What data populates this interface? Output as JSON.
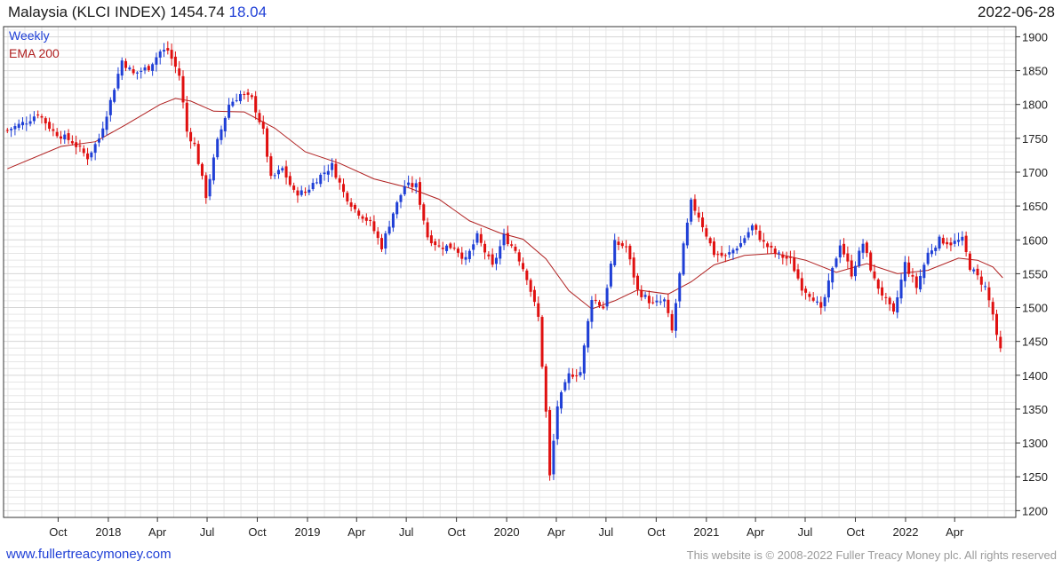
{
  "header": {
    "title": "Malaysia (KLCI INDEX) 1454.74",
    "change": "18.04",
    "date": "2022-06-28"
  },
  "footer": {
    "url": "www.fullertreacymoney.com",
    "copyright": "This website is © 2008-2022 Fuller Treacy Money plc. All rights reserved"
  },
  "colors": {
    "up": "#1f3fd6",
    "down": "#e01010",
    "ema": "#b02020",
    "grid": "#e6e6e6",
    "frame": "#333333"
  },
  "chart_data": {
    "type": "line",
    "subtype": "weekly candlestick with moving average",
    "title": "",
    "xlabel": "",
    "ylabel": "",
    "x_start": "2017-06-23",
    "x_end": "2022-07-22",
    "x_ticks": [
      {
        "label": "Oct",
        "date": "2017-10-01"
      },
      {
        "label": "2018",
        "date": "2018-01-01"
      },
      {
        "label": "Apr",
        "date": "2018-04-01"
      },
      {
        "label": "Jul",
        "date": "2018-07-01"
      },
      {
        "label": "Oct",
        "date": "2018-10-01"
      },
      {
        "label": "2019",
        "date": "2019-01-01"
      },
      {
        "label": "Apr",
        "date": "2019-04-01"
      },
      {
        "label": "Jul",
        "date": "2019-07-01"
      },
      {
        "label": "Oct",
        "date": "2019-10-01"
      },
      {
        "label": "2020",
        "date": "2020-01-01"
      },
      {
        "label": "Apr",
        "date": "2020-04-01"
      },
      {
        "label": "Jul",
        "date": "2020-07-01"
      },
      {
        "label": "Oct",
        "date": "2020-10-01"
      },
      {
        "label": "2021",
        "date": "2021-01-01"
      },
      {
        "label": "Apr",
        "date": "2021-04-01"
      },
      {
        "label": "Jul",
        "date": "2021-07-01"
      },
      {
        "label": "Oct",
        "date": "2021-10-01"
      },
      {
        "label": "2022",
        "date": "2022-01-01"
      },
      {
        "label": "Apr",
        "date": "2022-04-01"
      }
    ],
    "ylim": [
      1190,
      1915
    ],
    "y_ticks": [
      1200,
      1250,
      1300,
      1350,
      1400,
      1450,
      1500,
      1550,
      1600,
      1650,
      1700,
      1750,
      1800,
      1850,
      1900
    ],
    "grid": true,
    "legend_position": "top-left",
    "series": [
      {
        "name": "Weekly",
        "kind": "candlestick",
        "start_date": "2017-06-30",
        "interval_days": 7,
        "anchors": [
          {
            "date": "2017-06-30",
            "close": 1762
          },
          {
            "date": "2017-08-04",
            "close": 1775
          },
          {
            "date": "2017-08-25",
            "close": 1787
          },
          {
            "date": "2017-09-22",
            "close": 1760
          },
          {
            "date": "2017-10-27",
            "close": 1745
          },
          {
            "date": "2017-11-24",
            "close": 1722
          },
          {
            "date": "2017-12-15",
            "close": 1750
          },
          {
            "date": "2018-01-05",
            "close": 1805
          },
          {
            "date": "2018-01-26",
            "close": 1865
          },
          {
            "date": "2018-02-16",
            "close": 1845
          },
          {
            "date": "2018-03-16",
            "close": 1855
          },
          {
            "date": "2018-04-06",
            "close": 1878
          },
          {
            "date": "2018-04-20",
            "close": 1880
          },
          {
            "date": "2018-05-11",
            "close": 1843
          },
          {
            "date": "2018-05-25",
            "close": 1760
          },
          {
            "date": "2018-06-08",
            "close": 1740
          },
          {
            "date": "2018-06-29",
            "close": 1665
          },
          {
            "date": "2018-07-20",
            "close": 1745
          },
          {
            "date": "2018-08-10",
            "close": 1800
          },
          {
            "date": "2018-08-31",
            "close": 1815
          },
          {
            "date": "2018-09-21",
            "close": 1808
          },
          {
            "date": "2018-10-12",
            "close": 1760
          },
          {
            "date": "2018-10-26",
            "close": 1690
          },
          {
            "date": "2018-11-16",
            "close": 1705
          },
          {
            "date": "2018-12-07",
            "close": 1670
          },
          {
            "date": "2018-12-28",
            "close": 1670
          },
          {
            "date": "2019-01-18",
            "close": 1690
          },
          {
            "date": "2019-02-15",
            "close": 1710
          },
          {
            "date": "2019-03-08",
            "close": 1670
          },
          {
            "date": "2019-03-29",
            "close": 1645
          },
          {
            "date": "2019-04-26",
            "close": 1625
          },
          {
            "date": "2019-05-17",
            "close": 1590
          },
          {
            "date": "2019-06-07",
            "close": 1640
          },
          {
            "date": "2019-06-28",
            "close": 1680
          },
          {
            "date": "2019-07-19",
            "close": 1680
          },
          {
            "date": "2019-08-09",
            "close": 1605
          },
          {
            "date": "2019-08-30",
            "close": 1590
          },
          {
            "date": "2019-09-27",
            "close": 1590
          },
          {
            "date": "2019-10-18",
            "close": 1570
          },
          {
            "date": "2019-11-08",
            "close": 1605
          },
          {
            "date": "2019-12-06",
            "close": 1560
          },
          {
            "date": "2019-12-27",
            "close": 1605
          },
          {
            "date": "2020-01-17",
            "close": 1585
          },
          {
            "date": "2020-02-07",
            "close": 1545
          },
          {
            "date": "2020-02-28",
            "close": 1485
          },
          {
            "date": "2020-03-13",
            "close": 1345
          },
          {
            "date": "2020-03-20",
            "close": 1250
          },
          {
            "date": "2020-04-03",
            "close": 1355
          },
          {
            "date": "2020-04-24",
            "close": 1400
          },
          {
            "date": "2020-05-15",
            "close": 1405
          },
          {
            "date": "2020-06-05",
            "close": 1515
          },
          {
            "date": "2020-06-26",
            "close": 1500
          },
          {
            "date": "2020-07-17",
            "close": 1595
          },
          {
            "date": "2020-08-07",
            "close": 1590
          },
          {
            "date": "2020-08-28",
            "close": 1525
          },
          {
            "date": "2020-09-25",
            "close": 1505
          },
          {
            "date": "2020-10-16",
            "close": 1510
          },
          {
            "date": "2020-10-30",
            "close": 1465
          },
          {
            "date": "2020-11-20",
            "close": 1590
          },
          {
            "date": "2020-12-04",
            "close": 1655
          },
          {
            "date": "2020-12-18",
            "close": 1635
          },
          {
            "date": "2021-01-15",
            "close": 1580
          },
          {
            "date": "2021-02-05",
            "close": 1575
          },
          {
            "date": "2021-03-05",
            "close": 1595
          },
          {
            "date": "2021-03-26",
            "close": 1620
          },
          {
            "date": "2021-04-16",
            "close": 1595
          },
          {
            "date": "2021-05-07",
            "close": 1580
          },
          {
            "date": "2021-06-04",
            "close": 1570
          },
          {
            "date": "2021-06-25",
            "close": 1530
          },
          {
            "date": "2021-07-16",
            "close": 1515
          },
          {
            "date": "2021-07-30",
            "close": 1495
          },
          {
            "date": "2021-08-13",
            "close": 1535
          },
          {
            "date": "2021-09-03",
            "close": 1595
          },
          {
            "date": "2021-09-24",
            "close": 1550
          },
          {
            "date": "2021-10-15",
            "close": 1595
          },
          {
            "date": "2021-11-05",
            "close": 1540
          },
          {
            "date": "2021-11-26",
            "close": 1510
          },
          {
            "date": "2021-12-10",
            "close": 1490
          },
          {
            "date": "2021-12-31",
            "close": 1565
          },
          {
            "date": "2022-01-21",
            "close": 1530
          },
          {
            "date": "2022-02-11",
            "close": 1580
          },
          {
            "date": "2022-03-04",
            "close": 1600
          },
          {
            "date": "2022-03-25",
            "close": 1595
          },
          {
            "date": "2022-04-15",
            "close": 1600
          },
          {
            "date": "2022-04-29",
            "close": 1560
          },
          {
            "date": "2022-05-13",
            "close": 1545
          },
          {
            "date": "2022-05-27",
            "close": 1530
          },
          {
            "date": "2022-06-10",
            "close": 1490
          },
          {
            "date": "2022-06-17",
            "close": 1455
          },
          {
            "date": "2022-06-24",
            "close": 1437
          },
          {
            "date": "2022-06-28",
            "close": 1455
          }
        ]
      },
      {
        "name": "EMA 200",
        "kind": "line",
        "points": [
          {
            "date": "2017-06-30",
            "value": 1705
          },
          {
            "date": "2017-10-06",
            "value": 1738
          },
          {
            "date": "2017-12-08",
            "value": 1745
          },
          {
            "date": "2018-02-02",
            "value": 1770
          },
          {
            "date": "2018-04-06",
            "value": 1800
          },
          {
            "date": "2018-05-04",
            "value": 1809
          },
          {
            "date": "2018-06-01",
            "value": 1805
          },
          {
            "date": "2018-07-13",
            "value": 1790
          },
          {
            "date": "2018-09-07",
            "value": 1789
          },
          {
            "date": "2018-11-02",
            "value": 1765
          },
          {
            "date": "2018-12-28",
            "value": 1730
          },
          {
            "date": "2019-03-01",
            "value": 1713
          },
          {
            "date": "2019-05-03",
            "value": 1690
          },
          {
            "date": "2019-07-05",
            "value": 1677
          },
          {
            "date": "2019-08-30",
            "value": 1660
          },
          {
            "date": "2019-10-25",
            "value": 1628
          },
          {
            "date": "2019-12-20",
            "value": 1610
          },
          {
            "date": "2020-01-31",
            "value": 1601
          },
          {
            "date": "2020-03-13",
            "value": 1572
          },
          {
            "date": "2020-04-24",
            "value": 1525
          },
          {
            "date": "2020-06-05",
            "value": 1498
          },
          {
            "date": "2020-07-17",
            "value": 1510
          },
          {
            "date": "2020-08-28",
            "value": 1526
          },
          {
            "date": "2020-10-23",
            "value": 1520
          },
          {
            "date": "2020-12-04",
            "value": 1538
          },
          {
            "date": "2021-01-15",
            "value": 1563
          },
          {
            "date": "2021-03-12",
            "value": 1577
          },
          {
            "date": "2021-05-07",
            "value": 1580
          },
          {
            "date": "2021-07-02",
            "value": 1570
          },
          {
            "date": "2021-08-27",
            "value": 1552
          },
          {
            "date": "2021-10-22",
            "value": 1565
          },
          {
            "date": "2021-12-17",
            "value": 1550
          },
          {
            "date": "2022-02-11",
            "value": 1555
          },
          {
            "date": "2022-04-08",
            "value": 1573
          },
          {
            "date": "2022-05-13",
            "value": 1570
          },
          {
            "date": "2022-06-10",
            "value": 1560
          },
          {
            "date": "2022-06-28",
            "value": 1544
          }
        ]
      }
    ]
  }
}
